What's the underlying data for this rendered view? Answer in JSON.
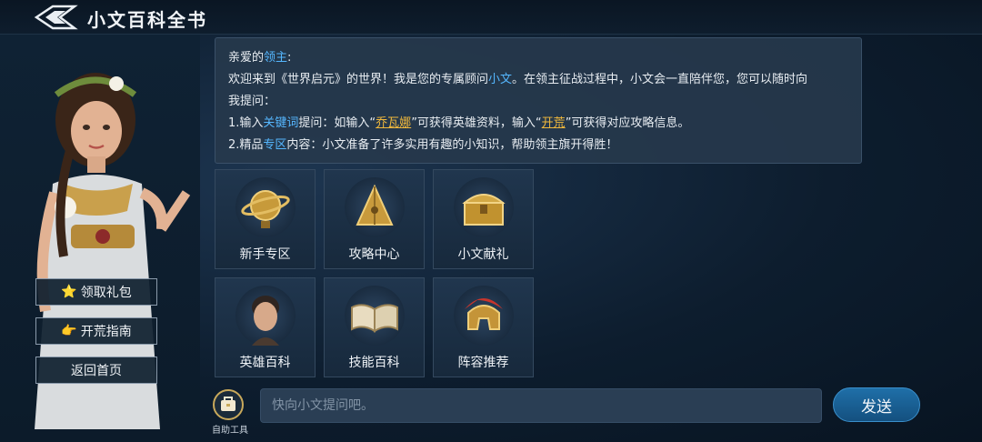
{
  "header": {
    "title": "小文百科全书"
  },
  "speech": {
    "greeting_pre": "亲爱的",
    "greeting_hl": "领主",
    "greeting_post": ":",
    "line1_a": "欢迎来到《世界启元》的世界！我是您的专属顾问",
    "line1_hl": "小文",
    "line1_b": "。在领主征战过程中，小文会一直陪伴您，您可以随时向",
    "line2": "我提问：",
    "line3_a": "1.输入",
    "line3_hl1": "关键词",
    "line3_b": "提问：如输入“",
    "line3_hl2": "乔瓦娜",
    "line3_c": "”可获得英雄资料，输入“",
    "line3_hl3": "开荒",
    "line3_d": "”可获得对应攻略信息。",
    "line4_a": "2.精品",
    "line4_hl": "专区",
    "line4_b": "内容：小文准备了许多实用有趣的小知识，帮助领主旗开得胜！"
  },
  "sidebar": {
    "gift_label": "领取礼包",
    "gift_emoji": "⭐",
    "guide_label": "开荒指南",
    "guide_emoji": "👉",
    "home_label": "返回首页"
  },
  "tiles": [
    {
      "label": "新手专区",
      "icon": "globe-icon"
    },
    {
      "label": "攻略中心",
      "icon": "pyramid-icon"
    },
    {
      "label": "小文献礼",
      "icon": "treasure-chest-icon"
    },
    {
      "label": "英雄百科",
      "icon": "hero-portrait-icon"
    },
    {
      "label": "技能百科",
      "icon": "open-book-icon"
    },
    {
      "label": "阵容推荐",
      "icon": "helmet-icon"
    }
  ],
  "bottom": {
    "tool_label": "自助工具",
    "input_placeholder": "快向小文提问吧。",
    "send_label": "发送"
  },
  "colors": {
    "accent_blue": "#55b7ff",
    "accent_gold": "#f0b83c"
  }
}
